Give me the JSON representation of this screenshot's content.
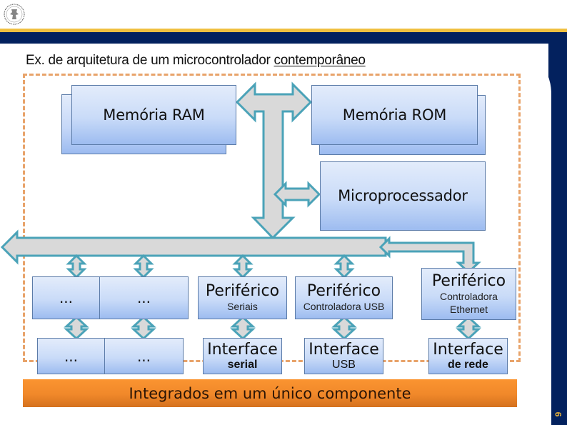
{
  "slide": {
    "title_prefix": "Ex. de arquitetura de um microcontrolador ",
    "title_underlined": "contemporâneo",
    "page_number": "9",
    "logo_icon": "university-seal-icon"
  },
  "colors": {
    "header_gold": "#f0c040",
    "header_navy": "#03215e",
    "box_border": "#5b7ba8",
    "box_fill_top": "#e3ecfb",
    "box_fill_bottom": "#9dbcf0",
    "arrow_fill": "#d9d9d9",
    "arrow_stroke": "#4ba3b8",
    "dashed_border": "#e8a36a",
    "integrated_bar": "#f0882a"
  },
  "diagram": {
    "memory_ram": "Memória RAM",
    "memory_rom": "Memória ROM",
    "microprocessor": "Microprocessador",
    "peripherals": [
      {
        "title": "...",
        "subtitle": ""
      },
      {
        "title": "...",
        "subtitle": ""
      },
      {
        "title": "Periférico",
        "subtitle": "Seriais"
      },
      {
        "title": "Periférico",
        "subtitle": "Controladora USB"
      },
      {
        "title": "Periférico",
        "subtitle": "Controladora Ethernet"
      }
    ],
    "interfaces": [
      {
        "title": "...",
        "subtitle": ""
      },
      {
        "title": "...",
        "subtitle": ""
      },
      {
        "title": "Interface",
        "subtitle": "serial"
      },
      {
        "title": "Interface",
        "subtitle": "USB"
      },
      {
        "title": "Interface",
        "subtitle": "de rede"
      }
    ],
    "integrated_label": "Integrados em um único componente"
  }
}
